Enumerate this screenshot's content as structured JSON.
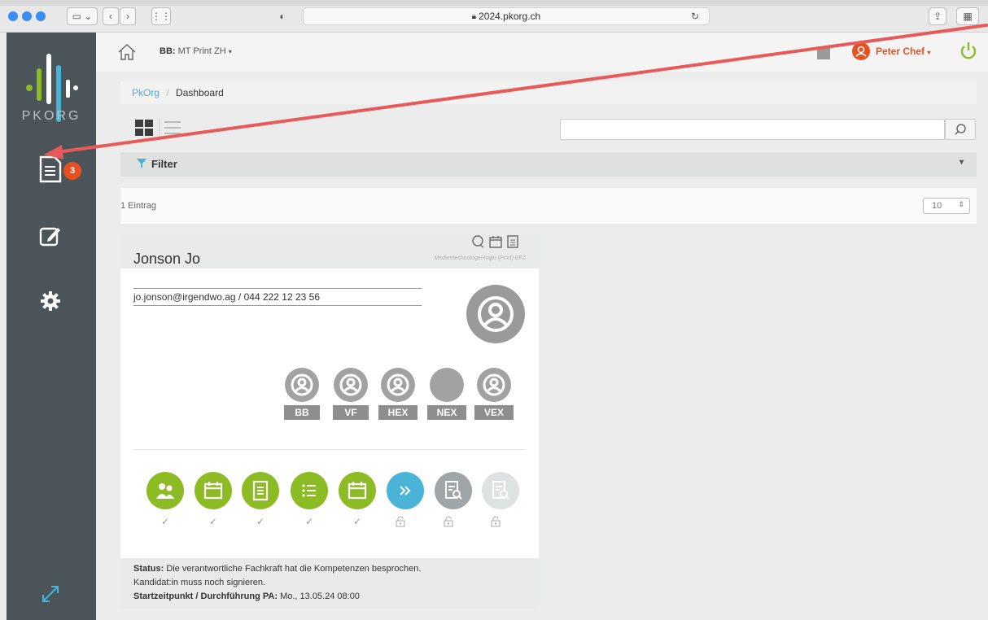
{
  "browser": {
    "url": "2024.pkorg.ch"
  },
  "sidebar": {
    "logo_text": "PKORG",
    "documents_badge": "3"
  },
  "header": {
    "bb_prefix": "BB:",
    "bb_value": "MT Print ZH",
    "user_name": "Peter Chef"
  },
  "breadcrumb": {
    "root": "PkOrg",
    "separator": "/",
    "current": "Dashboard"
  },
  "filter": {
    "label": "Filter"
  },
  "listing": {
    "entries_count": "1 Eintrag",
    "page_size": "10"
  },
  "card": {
    "name": "Jonson Jo",
    "subtitle": "Medientechnologe/-login (Print) EFZ",
    "contact": "jo.jonson@irgendwo.ag / 044 222 12 23 56",
    "roles": [
      "BB",
      "VF",
      "HEX",
      "NEX",
      "VEX"
    ],
    "step_marks": [
      "✓",
      "✓",
      "✓",
      "✓",
      "✓"
    ],
    "status_label": "Status:",
    "status_text": "Die verantwortliche Fachkraft hat die Kompetenzen besprochen.",
    "status_text2": "Kandidat:in muss noch signieren.",
    "start_label": "Startzeitpunkt / Durchführung PA:",
    "start_value": "Mo., 13.05.24 08:00"
  },
  "colors": {
    "accent_green": "#8dbb23",
    "accent_blue": "#4ab3d8",
    "orange": "#e8501f",
    "sidebar": "#4b5559",
    "arrow": "#e85a5a"
  }
}
